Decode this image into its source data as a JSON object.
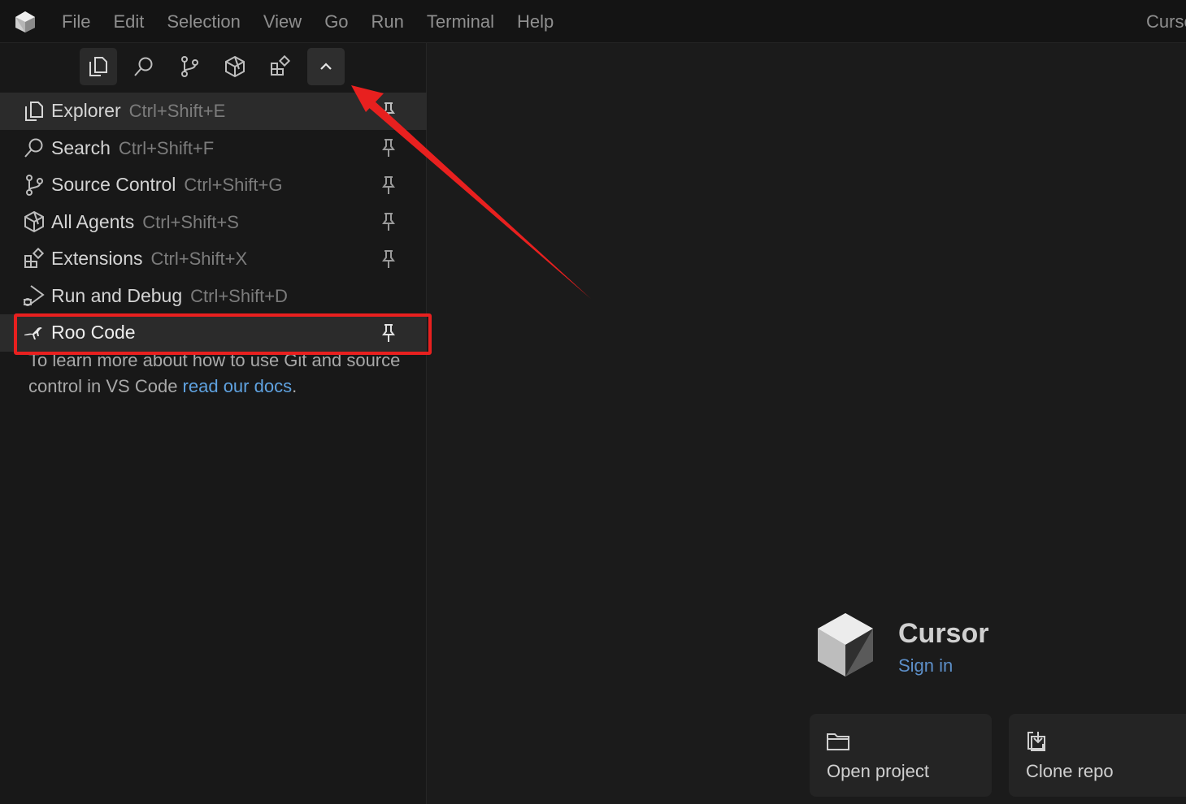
{
  "menubar": {
    "items": [
      "File",
      "Edit",
      "Selection",
      "View",
      "Go",
      "Run",
      "Terminal",
      "Help"
    ],
    "window_title": "Cursor"
  },
  "sidebar": {
    "tabs": [
      {
        "name": "explorer",
        "icon": "files-icon",
        "active": true
      },
      {
        "name": "search",
        "icon": "search-icon"
      },
      {
        "name": "source-control",
        "icon": "source-control-icon"
      },
      {
        "name": "agents",
        "icon": "cube-icon"
      },
      {
        "name": "extensions",
        "icon": "extensions-icon"
      },
      {
        "name": "collapse",
        "icon": "chevron-up-icon"
      }
    ],
    "views": [
      {
        "label": "Explorer",
        "shortcut": "Ctrl+Shift+E",
        "icon": "files-icon",
        "highlight": true
      },
      {
        "label": "Search",
        "shortcut": "Ctrl+Shift+F",
        "icon": "search-icon"
      },
      {
        "label": "Source Control",
        "shortcut": "Ctrl+Shift+G",
        "icon": "source-control-icon"
      },
      {
        "label": "All Agents",
        "shortcut": "Ctrl+Shift+S",
        "icon": "cube-icon"
      },
      {
        "label": "Extensions",
        "shortcut": "Ctrl+Shift+X",
        "icon": "extensions-icon"
      },
      {
        "label": "Run and Debug",
        "shortcut": "Ctrl+Shift+D",
        "icon": "run-debug-icon"
      },
      {
        "label": "Roo Code",
        "shortcut": "",
        "icon": "kangaroo-icon",
        "highlight": true
      }
    ],
    "docs_text": "To learn more about how to use Git and source control in VS Code ",
    "docs_link": "read our docs",
    "docs_end": "."
  },
  "editor": {
    "brand": "Cursor",
    "sign_in": "Sign in",
    "actions": [
      {
        "label": "Open project",
        "icon": "folder-icon"
      },
      {
        "label": "Clone repo",
        "icon": "clone-icon"
      }
    ]
  },
  "colors": {
    "annotation": "#e8201f",
    "link": "#5fa2e0",
    "sign_in": "#5d8fc8"
  }
}
